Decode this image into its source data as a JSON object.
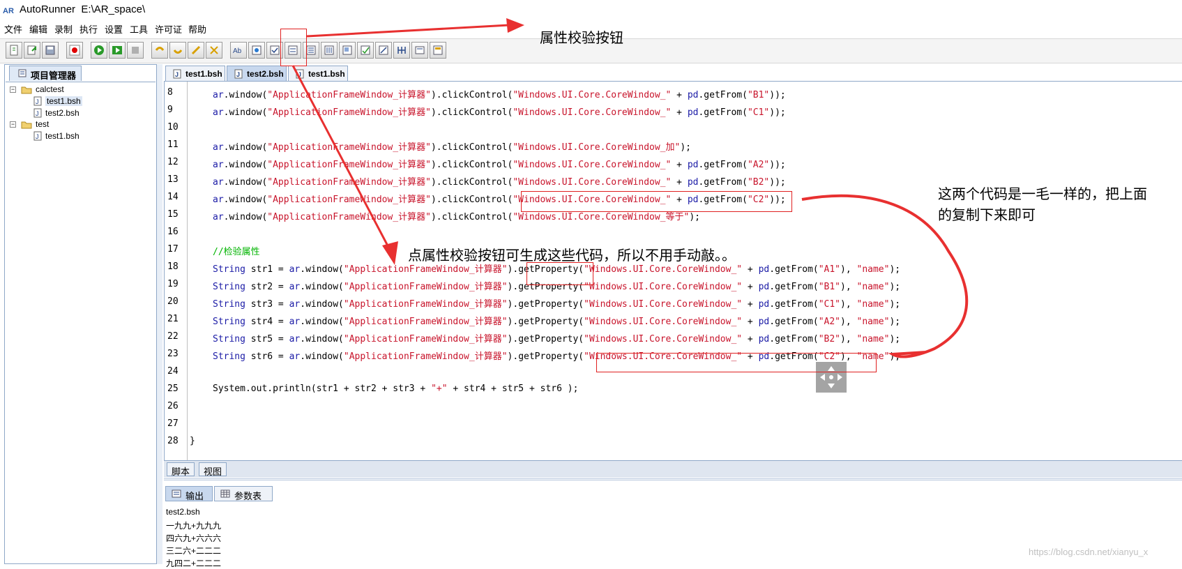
{
  "window": {
    "app_name": "AutoRunner",
    "path": "E:\\AR_space\\"
  },
  "menu": [
    "文件",
    "编辑",
    "录制",
    "执行",
    "设置",
    "工具",
    "许可证",
    "帮助"
  ],
  "project_panel": {
    "tab_label": "项目管理器",
    "tree": [
      {
        "name": "calctest",
        "files": [
          "test1.bsh",
          "test2.bsh"
        ]
      },
      {
        "name": "test",
        "files": [
          "test1.bsh"
        ]
      }
    ]
  },
  "editor_tabs": [
    "test1.bsh",
    "test2.bsh",
    "test1.bsh"
  ],
  "active_editor_tab": "test2.bsh",
  "code_lines": [
    {
      "n": "8",
      "text": "ar.window(\"ApplicationFrameWindow_计算器\").clickControl(\"Windows.UI.Core.CoreWindow_\" + pd.getFrom(\"B1\"));"
    },
    {
      "n": "9",
      "text": "ar.window(\"ApplicationFrameWindow_计算器\").clickControl(\"Windows.UI.Core.CoreWindow_\" + pd.getFrom(\"C1\"));"
    },
    {
      "n": "10",
      "text": ""
    },
    {
      "n": "11",
      "text": "ar.window(\"ApplicationFrameWindow_计算器\").clickControl(\"Windows.UI.Core.CoreWindow_加\");"
    },
    {
      "n": "12",
      "text": "ar.window(\"ApplicationFrameWindow_计算器\").clickControl(\"Windows.UI.Core.CoreWindow_\" + pd.getFrom(\"A2\"));"
    },
    {
      "n": "13",
      "text": "ar.window(\"ApplicationFrameWindow_计算器\").clickControl(\"Windows.UI.Core.CoreWindow_\" + pd.getFrom(\"B2\"));"
    },
    {
      "n": "14",
      "text": "ar.window(\"ApplicationFrameWindow_计算器\").clickControl(\"Windows.UI.Core.CoreWindow_\" + pd.getFrom(\"C2\"));"
    },
    {
      "n": "15",
      "text": "ar.window(\"ApplicationFrameWindow_计算器\").clickControl(\"Windows.UI.Core.CoreWindow_等于\");"
    },
    {
      "n": "16",
      "text": ""
    },
    {
      "n": "17",
      "text": "//检验属性"
    },
    {
      "n": "18",
      "text": "String str1 = ar.window(\"ApplicationFrameWindow_计算器\").getProperty(\"Windows.UI.Core.CoreWindow_\" + pd.getFrom(\"A1\"), \"name\");"
    },
    {
      "n": "19",
      "text": "String str2 = ar.window(\"ApplicationFrameWindow_计算器\").getProperty(\"Windows.UI.Core.CoreWindow_\" + pd.getFrom(\"B1\"), \"name\");"
    },
    {
      "n": "20",
      "text": "String str3 = ar.window(\"ApplicationFrameWindow_计算器\").getProperty(\"Windows.UI.Core.CoreWindow_\" + pd.getFrom(\"C1\"), \"name\");"
    },
    {
      "n": "21",
      "text": "String str4 = ar.window(\"ApplicationFrameWindow_计算器\").getProperty(\"Windows.UI.Core.CoreWindow_\" + pd.getFrom(\"A2\"), \"name\");"
    },
    {
      "n": "22",
      "text": "String str5 = ar.window(\"ApplicationFrameWindow_计算器\").getProperty(\"Windows.UI.Core.CoreWindow_\" + pd.getFrom(\"B2\"), \"name\");"
    },
    {
      "n": "23",
      "text": "String str6 = ar.window(\"ApplicationFrameWindow_计算器\").getProperty(\"Windows.UI.Core.CoreWindow_\" + pd.getFrom(\"C2\"), \"name\");"
    },
    {
      "n": "24",
      "text": ""
    },
    {
      "n": "25",
      "text": "System.out.println(str1 + str2 + str3 + \"+\" + str4 + str5 + str6 );"
    },
    {
      "n": "26",
      "text": ""
    },
    {
      "n": "27",
      "text": ""
    },
    {
      "n": "28",
      "text": "}"
    }
  ],
  "view_tabs": [
    "脚本",
    "视图"
  ],
  "output_tabs": [
    "输出",
    "参数表"
  ],
  "output_lines": [
    "test2.bsh",
    "一九九+九九九",
    "四六九+六六六",
    "三二六+二二二",
    "九四二+二二二"
  ],
  "annotations": {
    "toolbar_note": "属性校验按钮",
    "code_note": "点属性校验按钮可生成这些代码，所以不用手动敲。。",
    "side_note_line1": "这两个代码是一毛一样的，把上面",
    "side_note_line2": "的复制下来即可"
  },
  "watermark": "https://blog.csdn.net/xianyu_x",
  "colors": {
    "annotation_red": "#e02020",
    "string_red": "#c8142b",
    "keyword_blue": "#1a1aa6",
    "comment_green": "#00b400"
  }
}
